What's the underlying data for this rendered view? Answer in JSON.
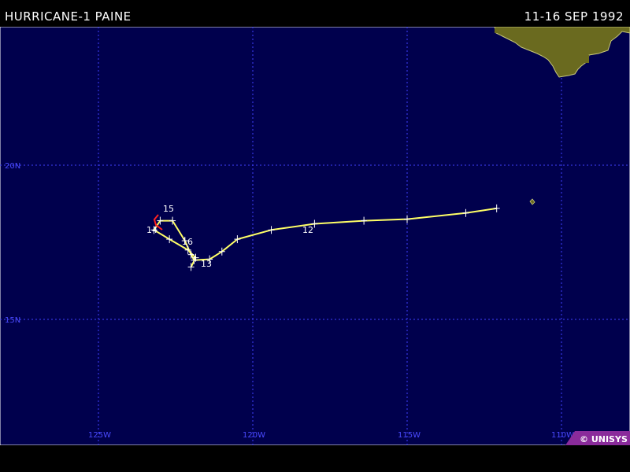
{
  "header": {
    "title": "HURRICANE-1 PAINE",
    "dates": "11-16 SEP 1992"
  },
  "map": {
    "ocean_color": "#00004d",
    "grid_color": "#3f3fff",
    "land_color": "#6a6a1f",
    "land_outline_color": "#c8c87a",
    "track_color": "#ffff66",
    "track_depression_color": "#ff2020",
    "lat_labels": [
      "20N",
      "15N"
    ],
    "lon_labels": [
      "125W",
      "120W",
      "115W",
      "110W"
    ],
    "day_labels": [
      "12",
      "13",
      "14",
      "15",
      "16"
    ],
    "credit": "© UNISYS"
  },
  "track": [
    {
      "lon": -112.1,
      "lat": 18.6
    },
    {
      "lon": -113.1,
      "lat": 18.45
    },
    {
      "lon": -115.0,
      "lat": 18.25
    },
    {
      "lon": -116.4,
      "lat": 18.2
    },
    {
      "lon": -118.0,
      "lat": 18.1
    },
    {
      "lon": -119.4,
      "lat": 17.9
    },
    {
      "lon": -120.5,
      "lat": 17.6
    },
    {
      "lon": -121.0,
      "lat": 17.2
    },
    {
      "lon": -121.4,
      "lat": 16.95
    },
    {
      "lon": -121.9,
      "lat": 16.92
    },
    {
      "lon": -122.0,
      "lat": 17.1
    },
    {
      "lon": -122.2,
      "lat": 17.55
    },
    {
      "lon": -122.6,
      "lat": 18.2
    },
    {
      "lon": -123.0,
      "lat": 18.2
    },
    {
      "lon": -123.2,
      "lat": 17.9
    },
    {
      "lon": -122.7,
      "lat": 17.6
    },
    {
      "lon": -122.1,
      "lat": 17.25
    },
    {
      "lon": -121.85,
      "lat": 17.0
    },
    {
      "lon": -122.0,
      "lat": 16.7
    }
  ]
}
